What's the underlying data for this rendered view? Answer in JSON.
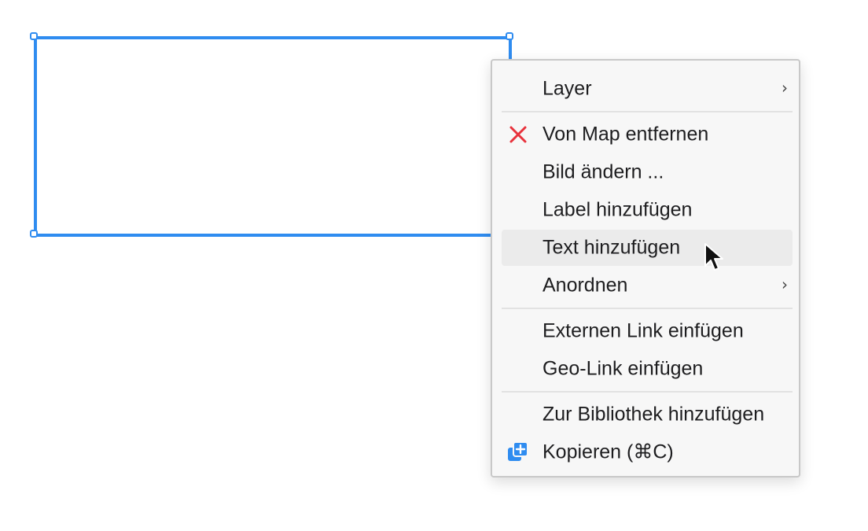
{
  "menu": {
    "items": {
      "layer": {
        "label": "Layer",
        "submenu_indicator": "›"
      },
      "remove": {
        "label": "Von Map entfernen",
        "icon": "close-icon",
        "icon_color": "#e8323c"
      },
      "change_image": {
        "label": "Bild ändern ..."
      },
      "add_label": {
        "label": "Label hinzufügen"
      },
      "add_text": {
        "label": "Text hinzufügen",
        "state": "hovered"
      },
      "arrange": {
        "label": "Anordnen",
        "submenu_indicator": "›"
      },
      "external_link": {
        "label": "Externen Link einfügen"
      },
      "geo_link": {
        "label": "Geo-Link einfügen"
      },
      "add_library": {
        "label": "Zur Bibliothek hinzufügen"
      },
      "copy": {
        "label": "Kopieren (⌘C)",
        "icon": "copy-icon",
        "icon_color": "#2f8cf0"
      }
    }
  },
  "colors": {
    "selection": "#2f8cf0",
    "menu_background": "#f7f7f7",
    "hover_background": "#ebebeb"
  }
}
